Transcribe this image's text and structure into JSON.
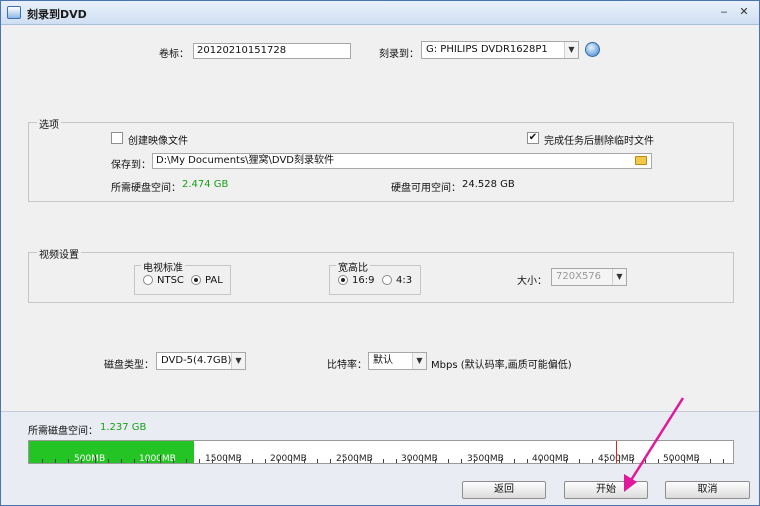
{
  "window": {
    "title": "刻录到DVD"
  },
  "header": {
    "volume_label": "卷标：",
    "volume_value": "20120210151728",
    "burn_to_label": "刻录到：",
    "burn_to_value": "G: PHILIPS  DVDR1628P1"
  },
  "options": {
    "title": "选项",
    "create_image_label": "创建映像文件",
    "create_image_checked": false,
    "delete_temp_label": "完成任务后删除临时文件",
    "delete_temp_checked": true,
    "save_to_label": "保存到：",
    "save_to_value": "D:\\My Documents\\狸窝\\DVD刻录软件",
    "required_disk_label": "所需硬盘空间：",
    "required_disk_value": "2.474 GB",
    "available_disk_label": "硬盘可用空间：",
    "available_disk_value": "24.528 GB"
  },
  "video": {
    "title": "视频设置",
    "standard_title": "电视标准",
    "ntsc_label": "NTSC",
    "pal_label": "PAL",
    "standard_selected": "PAL",
    "aspect_title": "宽高比",
    "aspect_169_label": "16:9",
    "aspect_43_label": "4:3",
    "aspect_selected": "16:9",
    "size_label": "大小：",
    "size_value": "720X576"
  },
  "disc": {
    "type_label": "磁盘类型：",
    "type_value": "DVD-5(4.7GB)",
    "bitrate_label": "比特率：",
    "bitrate_value": "默认",
    "bitrate_note": "Mbps (默认码率,画质可能偏低)"
  },
  "usage": {
    "label": "所需磁盘空间：",
    "value": "1.237 GB",
    "used_fraction": 0.234,
    "capacity_marker_mb": 4480,
    "ticks": [
      "500MB",
      "1000MB",
      "1500MB",
      "2000MB",
      "2500MB",
      "3000MB",
      "3500MB",
      "4000MB",
      "4500MB",
      "5000MB"
    ]
  },
  "buttons": {
    "back": "返回",
    "start": "开始",
    "cancel": "取消"
  },
  "colors": {
    "accent_green": "#23c423",
    "annotation_arrow": "#e0189c",
    "marker_red": "#e02020"
  }
}
